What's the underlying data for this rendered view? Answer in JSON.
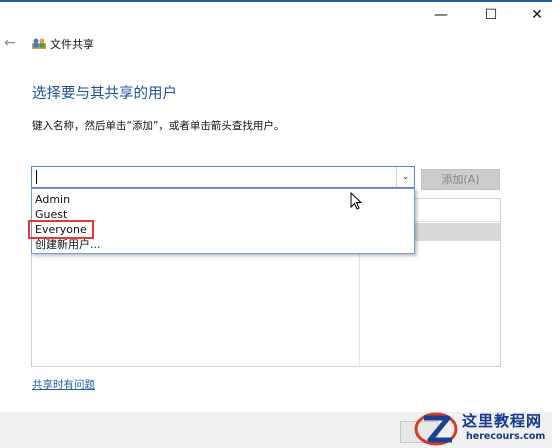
{
  "window": {
    "title": "文件共享",
    "controls": {
      "minimize": "—",
      "maximize": "☐",
      "close": "✕"
    },
    "back_glyph": "←"
  },
  "main": {
    "heading": "选择要与其共享的用户",
    "instruction": "键入名称，然后单击“添加”，或者单击箭头查找用户。",
    "combo": {
      "value": "",
      "arrow_glyph": "⌄"
    },
    "add_button": "添加(A)",
    "dropdown_options": [
      "Admin",
      "Guest",
      "Everyone",
      "创建新用户..."
    ],
    "highlighted_option": "Everyone",
    "help_link": "共享时有问题"
  },
  "watermark": {
    "title": "这里教程网",
    "url": "herecours.com"
  },
  "colors": {
    "heading": "#1e4f9a",
    "link": "#1e5fa8",
    "highlight_border": "#e23a3a",
    "combo_border": "#5b87c2"
  }
}
